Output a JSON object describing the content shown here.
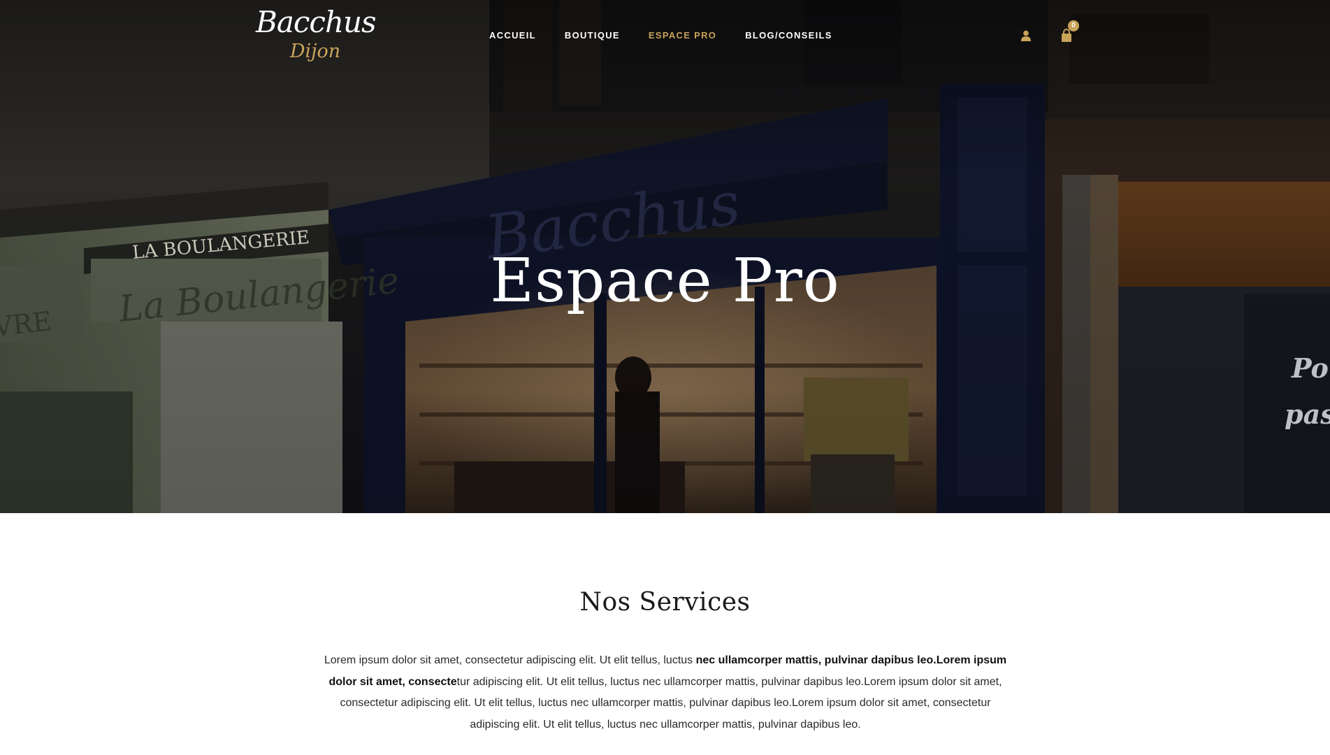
{
  "brand": {
    "name": "Bacchus",
    "city": "Dijon"
  },
  "nav": {
    "items": [
      {
        "label": "ACCUEIL",
        "active": false
      },
      {
        "label": "BOUTIQUE",
        "active": false
      },
      {
        "label": "ESPACE PRO",
        "active": true
      },
      {
        "label": "BLOG/CONSEILS",
        "active": false
      }
    ]
  },
  "header_icons": {
    "account_icon": "user-icon",
    "cart_icon": "shopping-bag-icon",
    "cart_count": "0"
  },
  "hero": {
    "title": "Espace Pro",
    "photo_signs": {
      "bakery_awning": "LA BOULANGERIE",
      "bakery_sign": "La Boulangerie",
      "left_partial": "VRE",
      "right_partial_1": "Po",
      "right_partial_2": "pas"
    }
  },
  "services": {
    "title": "Nos Services",
    "text_part1": "Lorem ipsum dolor sit amet, consectetur adipiscing elit. Ut elit tellus, luctus ",
    "text_bold": "nec ullamcorper mattis, pulvinar dapibus leo.Lorem ipsum dolor sit amet, consecte",
    "text_part2": "tur adipiscing elit. Ut elit tellus, luctus nec ullamcorper mattis, pulvinar dapibus leo.Lorem ipsum dolor sit amet, consectetur adipiscing elit. Ut elit tellus, luctus nec ullamcorper mattis, pulvinar dapibus leo.Lorem ipsum dolor sit amet, consectetur adipiscing elit. Ut elit tellus, luctus nec ullamcorper mattis, pulvinar dapibus leo."
  },
  "colors": {
    "accent_gold": "#c9a35a",
    "hero_overlay": "#0c0d14",
    "text_dark": "#1a1a1a"
  }
}
